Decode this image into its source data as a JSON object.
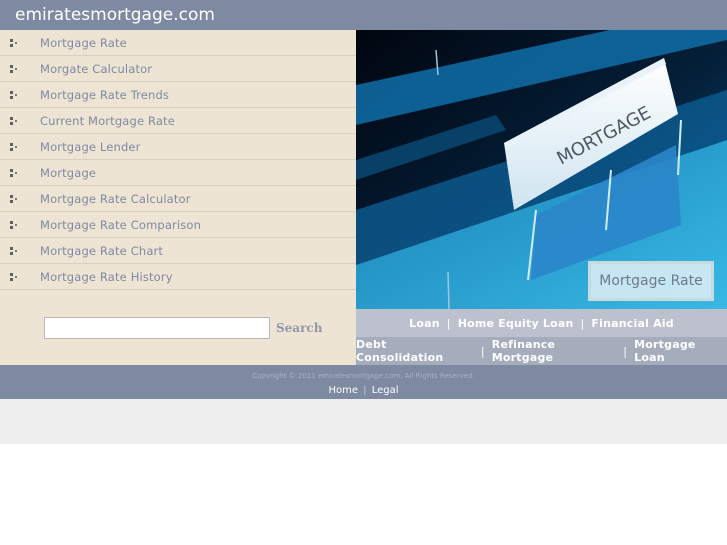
{
  "header": {
    "site_title": "emiratesmortgage.com"
  },
  "sidebar": {
    "bullet_icon": "square-dots-bullet",
    "items": [
      {
        "label": "Mortgage Rate"
      },
      {
        "label": "Morgate Calculator"
      },
      {
        "label": "Mortgage Rate Trends"
      },
      {
        "label": "Current Mortgage Rate"
      },
      {
        "label": "Mortgage Lender"
      },
      {
        "label": "Mortgage"
      },
      {
        "label": "Mortgage Rate Calculator"
      },
      {
        "label": "Mortgage Rate Comparison"
      },
      {
        "label": "Mortgage Rate Chart"
      },
      {
        "label": "Mortgage Rate History"
      }
    ]
  },
  "search": {
    "value": "",
    "placeholder": "",
    "button_label": "Search"
  },
  "hero": {
    "image_alt": "File folder tab labeled MORTGAGE",
    "tab_text": "MORTGAGE",
    "caption": "Mortgage Rate"
  },
  "links_row_1": {
    "items": [
      "Loan",
      "Home Equity Loan",
      "Financial Aid"
    ],
    "separator": "|"
  },
  "links_row_2": {
    "items": [
      "Debt Consolidation",
      "Refinance Mortgage",
      "Mortgage Loan"
    ],
    "separator": "|"
  },
  "footer": {
    "copyright": "Copyright © 2011 emiratesmortgage.com. All Rights Reserved.",
    "links": [
      "Home",
      "Legal"
    ],
    "separator": "|"
  },
  "colors": {
    "header_bg": "#7e8aa2",
    "sidebar_bg": "#eee4d3",
    "nav_text": "#7e8aa2",
    "links_row_1_bg": "#bcc1cd",
    "links_row_2_bg": "#a5acbc",
    "band_bg": "#eeeeee"
  }
}
